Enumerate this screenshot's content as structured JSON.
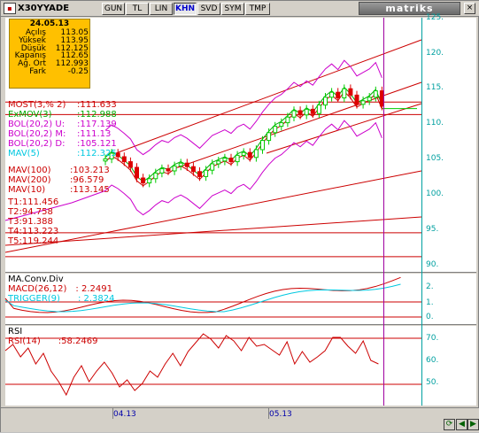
{
  "toolbar": {
    "symbol": "X30YYADE",
    "buttons": [
      "GUN",
      "TL",
      "LIN",
      "KHN",
      "SVD",
      "SYM",
      "TMP"
    ],
    "active_button": "KHN",
    "logo": "matriks"
  },
  "infobox": {
    "date": "24.05.13",
    "rows": [
      {
        "label": "Açılış",
        "value": "113.05"
      },
      {
        "label": "Yüksek",
        "value": "113.95"
      },
      {
        "label": "Düşük",
        "value": "112.125"
      },
      {
        "label": "Kapanış",
        "value": "112.65"
      },
      {
        "label": "Ağ. Ort",
        "value": "112.993"
      },
      {
        "label": "Fark",
        "value": "-0.25"
      }
    ]
  },
  "indicators": [
    {
      "label": "MOST(3,% 2)",
      "value": ":111.633",
      "color": "#cc0000"
    },
    {
      "label": "ExMOV(3)",
      "value": ":112.988",
      "color": "#00aa00"
    },
    {
      "label": "BOL(20,2) U:",
      "value": ":117.139",
      "color": "#cc00cc"
    },
    {
      "label": "BOL(20,2) M:",
      "value": ":111.13",
      "color": "#cc00cc"
    },
    {
      "label": "BOL(20,2) D:",
      "value": ":105.121",
      "color": "#cc00cc"
    },
    {
      "label": "MAV(5)",
      "value": ":112.325",
      "color": "#00c8e0"
    },
    {
      "label": "MAV(100)",
      "value": ":103.213",
      "color": "#cc0000"
    },
    {
      "label": "MAV(200)",
      "value": ":96.579",
      "color": "#cc0000"
    },
    {
      "label": "MAV(10)",
      "value": ":113.145",
      "color": "#cc0000"
    },
    {
      "label": "T1:111.456",
      "value": "",
      "color": "#cc0000"
    },
    {
      "label": "T2:94.758",
      "value": "",
      "color": "#cc0000"
    },
    {
      "label": "T3:91.388",
      "value": "",
      "color": "#cc0000"
    },
    {
      "label": "T4:113.223",
      "value": "",
      "color": "#cc0000"
    },
    {
      "label": "T5:119.244",
      "value": "",
      "color": "#cc0000"
    }
  ],
  "price_axis": [
    "125.",
    "120.",
    "115.",
    "110.",
    "105.",
    "100.",
    "95.",
    "90."
  ],
  "macd_panel": {
    "title": "MA.Conv.Div",
    "macd_label": "MACD(26,12)",
    "macd_value": ": 2.2491",
    "macd_color": "#cc0000",
    "trigger_label": "TRIGGER(9)",
    "trigger_value": ": 2.3824",
    "trigger_color": "#00c8e0",
    "axis": [
      "2.",
      "1.",
      "0."
    ]
  },
  "rsi_panel": {
    "title": "RSI",
    "rsi_label": "RSI(14)",
    "rsi_value": ":58.2469",
    "rsi_color": "#cc0000",
    "axis": [
      "70.",
      "60.",
      "50."
    ]
  },
  "time_axis": [
    "04.13",
    "05.13"
  ],
  "colors": {
    "up": "#00cc00",
    "down": "#dd0000",
    "cursor": "#a000a0",
    "background": "#ffffff"
  }
}
